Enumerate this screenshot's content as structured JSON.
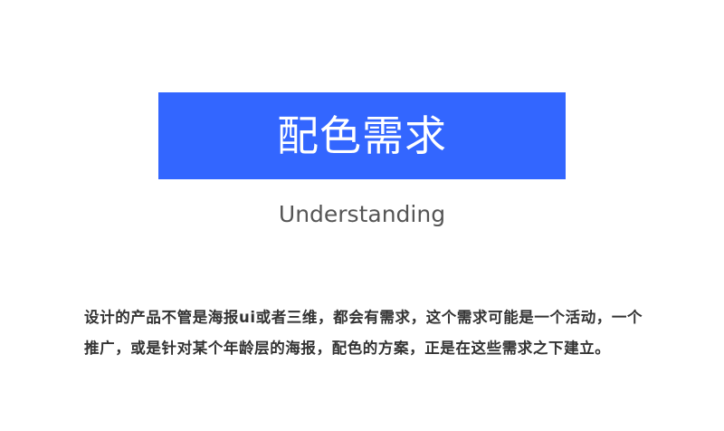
{
  "colors": {
    "accent": "#3366ff",
    "title_text": "#ffffff",
    "subtitle_text": "#555555",
    "body_text": "#333333"
  },
  "header": {
    "title": "配色需求",
    "subtitle": "Understanding"
  },
  "content": {
    "paragraph": "设计的产品不管是海报ui或者三维，都会有需求，这个需求可能是一个活动，一个推广，或是针对某个年龄层的海报，配色的方案，正是在这些需求之下建立。"
  }
}
